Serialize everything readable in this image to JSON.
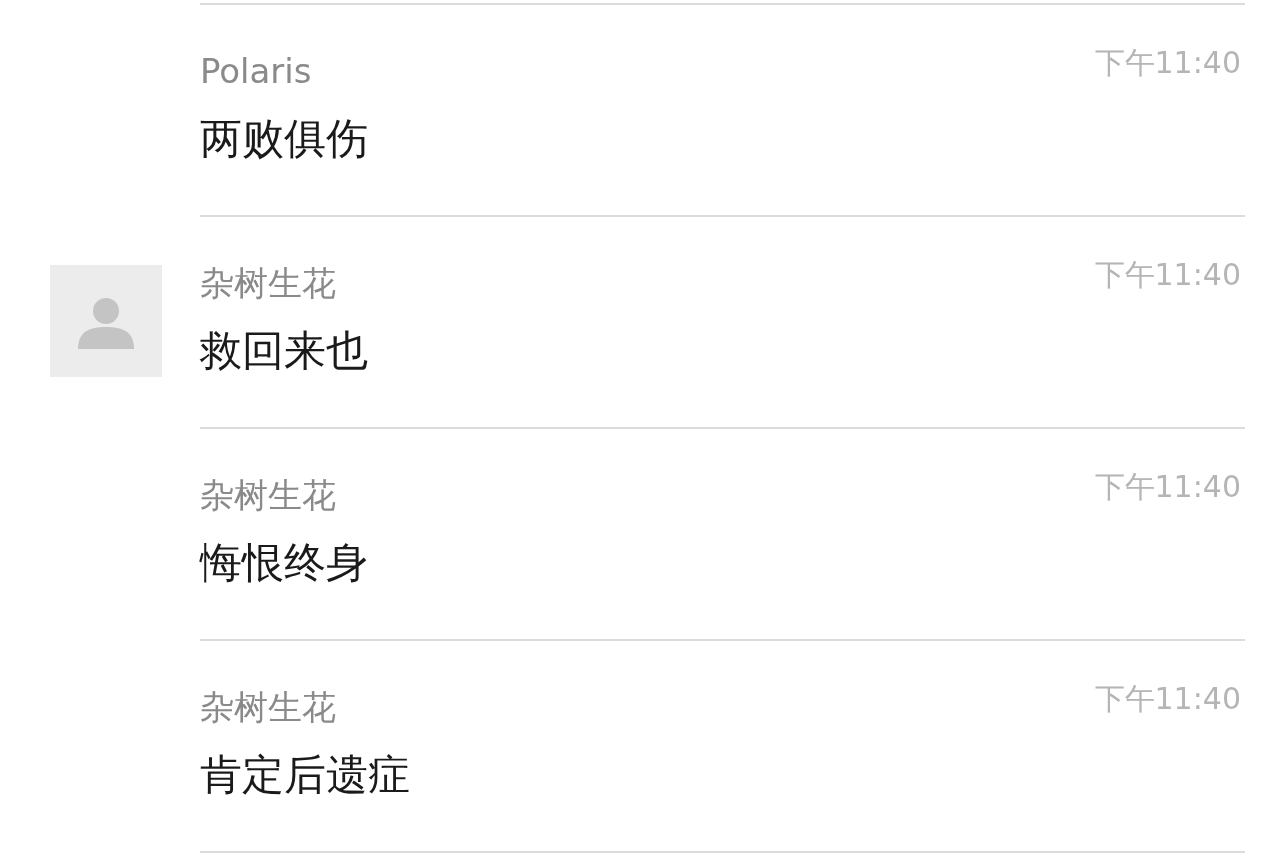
{
  "messages": [
    {
      "sender": "Polaris",
      "time": "下午11:40",
      "text": "两败俱伤",
      "avatar": false
    },
    {
      "sender": "杂树生花",
      "time": "下午11:40",
      "text": "救回来也",
      "avatar": true
    },
    {
      "sender": "杂树生花",
      "time": "下午11:40",
      "text": "悔恨终身",
      "avatar": false
    },
    {
      "sender": "杂树生花",
      "time": "下午11:40",
      "text": "肯定后遗症",
      "avatar": false
    }
  ]
}
